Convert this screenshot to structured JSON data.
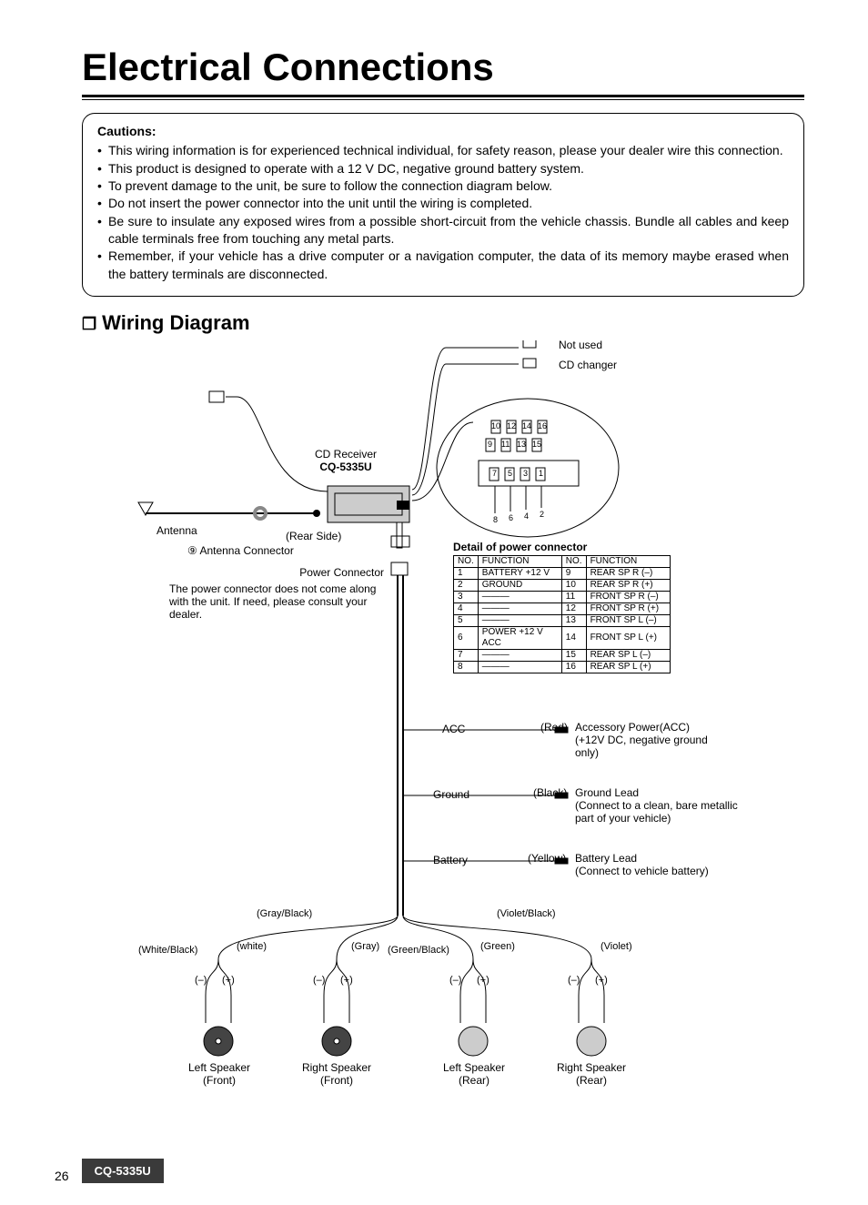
{
  "title": "Electrical Connections",
  "cautions": {
    "heading": "Cautions:",
    "items": [
      "This wiring information is for experienced technical individual, for safety reason, please your dealer wire this connection.",
      "This product is designed to operate with a 12 V DC, negative ground battery system.",
      "To prevent damage to the unit, be sure to follow the connection diagram below.",
      "Do not insert the power connector into the unit until the wiring is completed.",
      "Be sure to insulate any exposed wires from a possible short-circuit from the vehicle chassis. Bundle all cables and keep cable terminals free from touching any metal parts.",
      "Remember, if your vehicle has a drive computer or a navigation computer, the data of its memory maybe erased when the battery terminals are disconnected."
    ]
  },
  "section_title": "Wiring Diagram",
  "diagram": {
    "not_used": "Not used",
    "cd_changer": "CD changer",
    "cd_receiver": "CD Receiver",
    "model": "CQ-5335U",
    "antenna": "Antenna",
    "rear_side": "(Rear Side)",
    "antenna_connector": "Antenna Connector",
    "antenna_connector_num": "⑨",
    "power_connector": "Power Connector",
    "power_connector_note": "The power connector does not come along with the unit. If need, please consult your dealer.",
    "detail_heading": "Detail of power connector",
    "acc": "ACC",
    "acc_color": "(Red)",
    "acc_desc1": "Accessory Power(ACC)",
    "acc_desc2": "(+12V DC, negative ground only)",
    "ground": "Ground",
    "ground_color": "(Black)",
    "ground_desc1": "Ground Lead",
    "ground_desc2": "(Connect to a clean, bare metallic part of your vehicle)",
    "battery": "Battery",
    "battery_color": "(Yellow)",
    "battery_desc1": "Battery Lead",
    "battery_desc2": "(Connect to vehicle battery)",
    "speaker_colors": {
      "fl_neg": "(White/Black)",
      "fl_pos": "(white)",
      "fr_neg": "(Gray/Black)",
      "fr_pos": "(Gray)",
      "rl_neg": "(Green/Black)",
      "rl_pos": "(Green)",
      "rr_neg": "(Violet/Black)",
      "rr_pos": "(Violet)"
    },
    "polarity_neg": "(–)",
    "polarity_pos": "(+)",
    "speakers": {
      "fl1": "Left Speaker",
      "fl2": "(Front)",
      "fr1": "Right Speaker",
      "fr2": "(Front)",
      "rl1": "Left Speaker",
      "rl2": "(Rear)",
      "rr1": "Right Speaker",
      "rr2": "(Rear)"
    },
    "pin_nums_top": [
      "10",
      "12",
      "14",
      "16",
      "9",
      "11",
      "13",
      "15",
      "7",
      "5",
      "3",
      "1",
      "8",
      "6",
      "4",
      "2"
    ]
  },
  "detail_table": {
    "headers": {
      "no": "NO.",
      "fn": "FUNCTION"
    },
    "left": [
      {
        "no": "1",
        "fn": "BATTERY +12 V"
      },
      {
        "no": "2",
        "fn": "GROUND"
      },
      {
        "no": "3",
        "fn": "———"
      },
      {
        "no": "4",
        "fn": "———"
      },
      {
        "no": "5",
        "fn": "———"
      },
      {
        "no": "6",
        "fn": "POWER +12 V ACC"
      },
      {
        "no": "7",
        "fn": "———"
      },
      {
        "no": "8",
        "fn": "———"
      }
    ],
    "right": [
      {
        "no": "9",
        "fn": "REAR SP R (–)"
      },
      {
        "no": "10",
        "fn": "REAR SP R (+)"
      },
      {
        "no": "11",
        "fn": "FRONT SP R (–)"
      },
      {
        "no": "12",
        "fn": "FRONT SP R (+)"
      },
      {
        "no": "13",
        "fn": "FRONT SP L (–)"
      },
      {
        "no": "14",
        "fn": "FRONT SP L (+)"
      },
      {
        "no": "15",
        "fn": "REAR SP L (–)"
      },
      {
        "no": "16",
        "fn": "REAR SP L (+)"
      }
    ]
  },
  "footer": {
    "page": "26",
    "model": "CQ-5335U"
  }
}
